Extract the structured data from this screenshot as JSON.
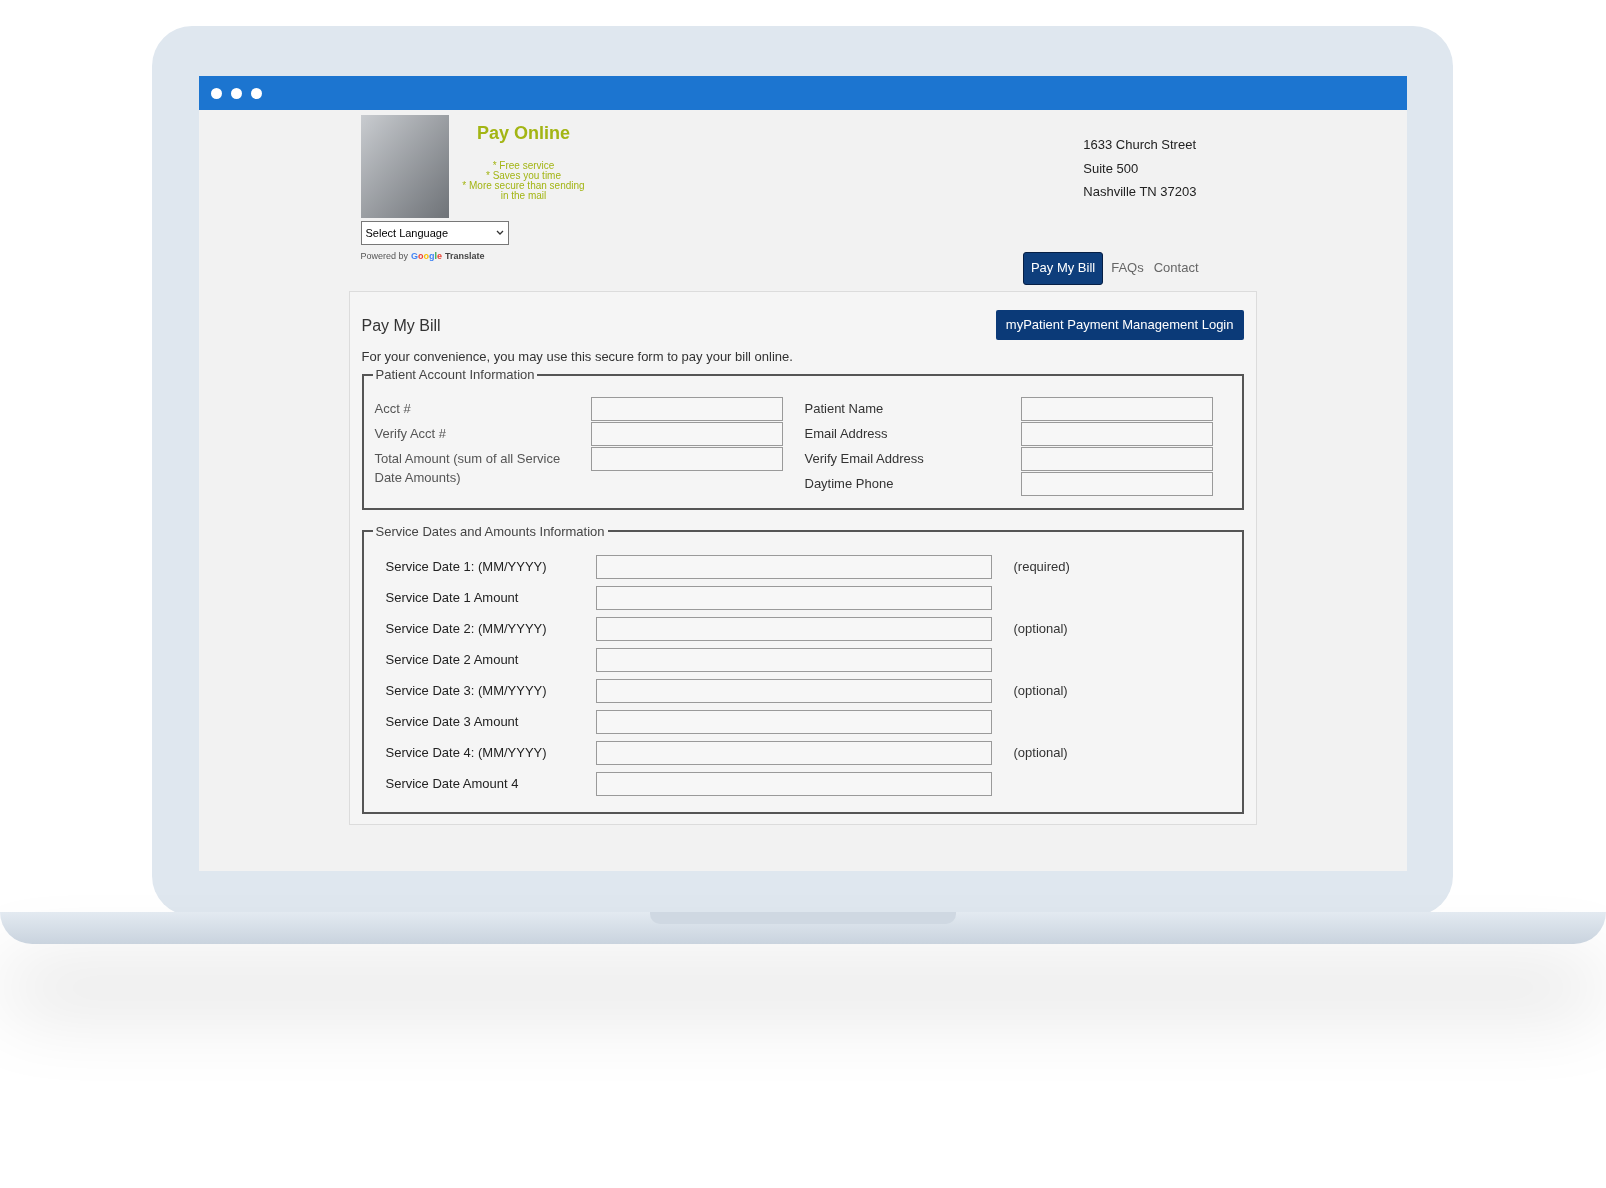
{
  "header": {
    "title": "Pay Online",
    "benefits": [
      "* Free service",
      "* Saves you time",
      "* More secure than sending in the mail"
    ],
    "language_select": {
      "value": "Select Language"
    },
    "powered_by": {
      "prefix": "Powered by",
      "brand": "Google",
      "product": "Translate"
    },
    "address": [
      "1633 Church Street",
      "Suite 500",
      "Nashville TN 37203"
    ]
  },
  "nav": [
    {
      "label": "Pay My Bill",
      "selected": true
    },
    {
      "label": "FAQs",
      "selected": false
    },
    {
      "label": "Contact",
      "selected": false
    }
  ],
  "panel": {
    "title": "Pay My Bill",
    "login_button": "myPatient Payment Management Login",
    "intro": "For your convenience, you may use this secure form to pay your bill online.",
    "account": {
      "legend": "Patient Account Information",
      "left_fields": [
        {
          "label": "Acct #"
        },
        {
          "label": "Verify Acct #"
        },
        {
          "label": "Total Amount (sum of all Service Date Amounts)"
        }
      ],
      "right_fields": [
        {
          "label": "Patient Name"
        },
        {
          "label": "Email Address"
        },
        {
          "label": "Verify Email Address"
        },
        {
          "label": "Daytime Phone"
        }
      ]
    },
    "service": {
      "legend": "Service Dates and Amounts Information",
      "rows": [
        {
          "label": "Service Date 1: (MM/YYYY)",
          "note": "(required)"
        },
        {
          "label": "Service Date 1 Amount"
        },
        {
          "label": "Service Date 2: (MM/YYYY)",
          "note": "(optional)"
        },
        {
          "label": "Service Date 2 Amount"
        },
        {
          "label": "Service Date 3: (MM/YYYY)",
          "note": "(optional)"
        },
        {
          "label": "Service Date 3 Amount"
        },
        {
          "label": "Service Date 4: (MM/YYYY)",
          "note": "(optional)"
        },
        {
          "label": "Service Date Amount 4"
        }
      ]
    }
  }
}
